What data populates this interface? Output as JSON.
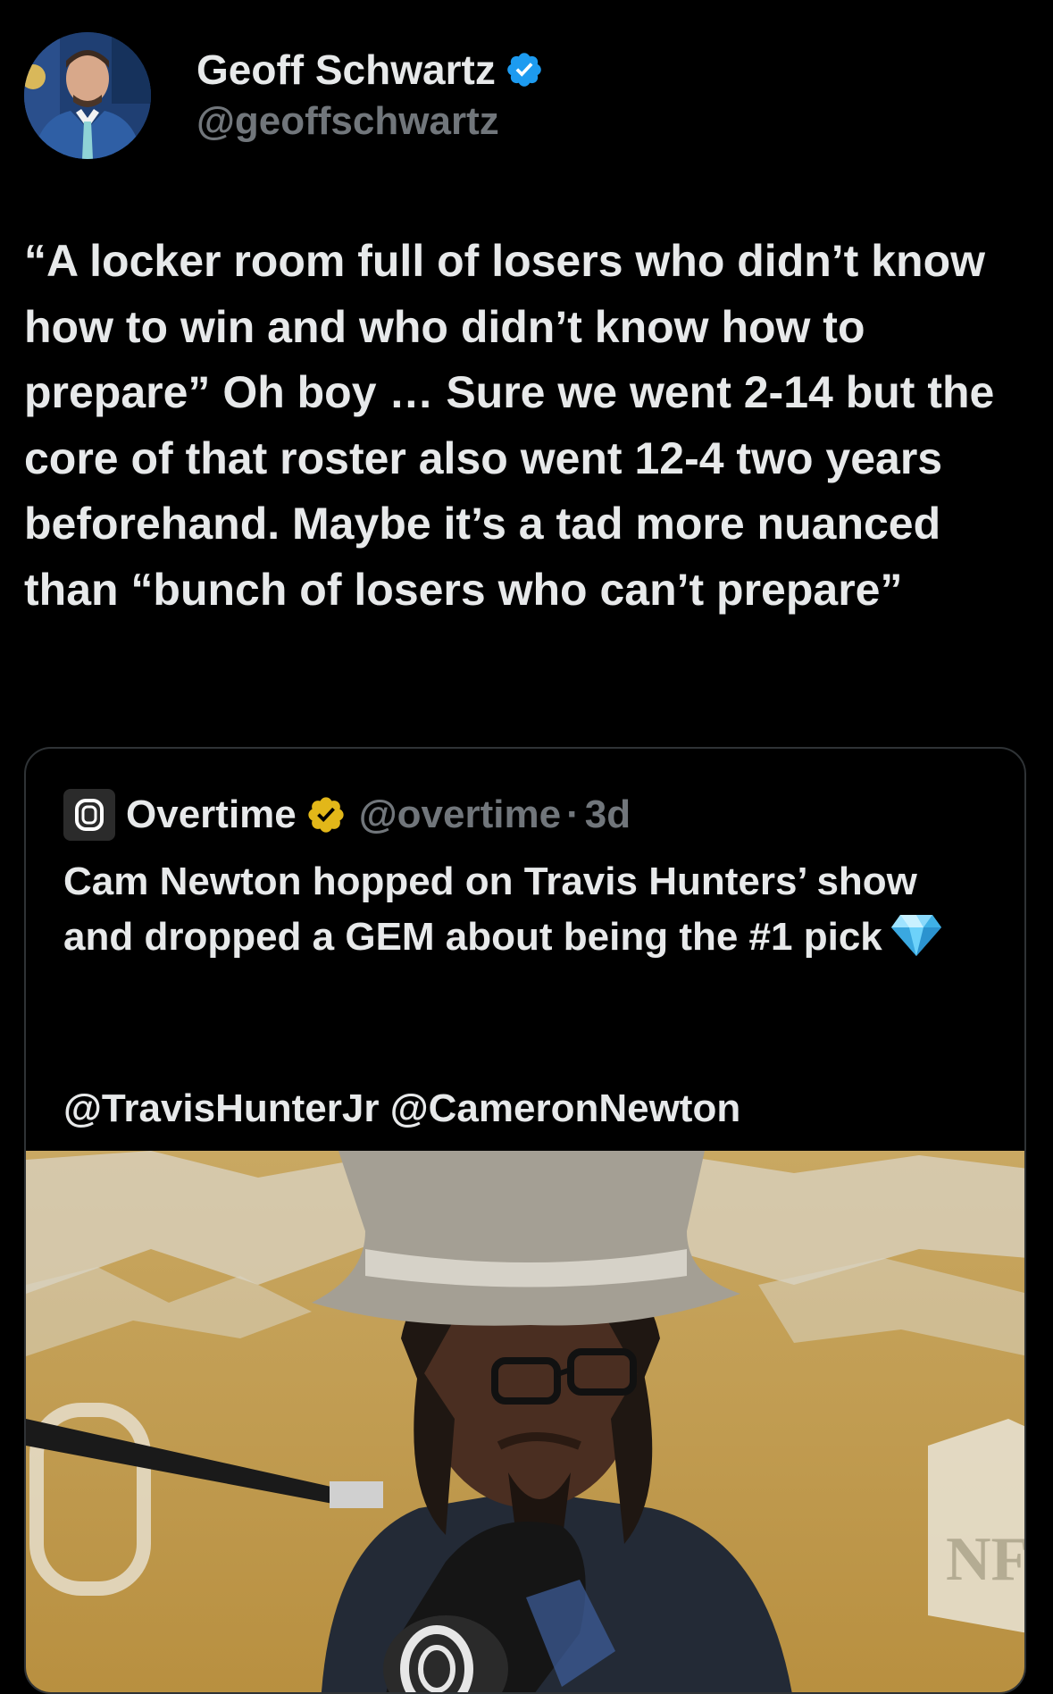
{
  "author": {
    "display_name": "Geoff Schwartz",
    "handle": "@geoffschwartz",
    "verified": "blue-checkmark-icon"
  },
  "tweet": {
    "text": "“A locker room full of losers who didn’t know how to win and who didn’t know how to prepare” Oh boy … Sure we went 2-14 but the core of that roster also went 12-4 two years beforehand. Maybe it’s a tad more nuanced than “bunch of losers who can’t prepare”"
  },
  "quoted_tweet": {
    "display_name": "Overtime",
    "handle": "@overtime",
    "separator": "·",
    "time": "3d",
    "verified": "gold-checkmark-icon",
    "text": "Cam Newton hopped on Travis Hunters’ show and dropped a GEM about being the #1 pick",
    "emoji": "gem-icon",
    "mentions": "@TravisHunterJr @CameronNewton",
    "media": "video-thumbnail"
  },
  "colors": {
    "background": "#000000",
    "text_primary": "#e7e9ea",
    "text_secondary": "#71767b",
    "border": "#2f3336",
    "verified_blue": "#1d9bf0",
    "verified_gold": "#e2b719"
  }
}
